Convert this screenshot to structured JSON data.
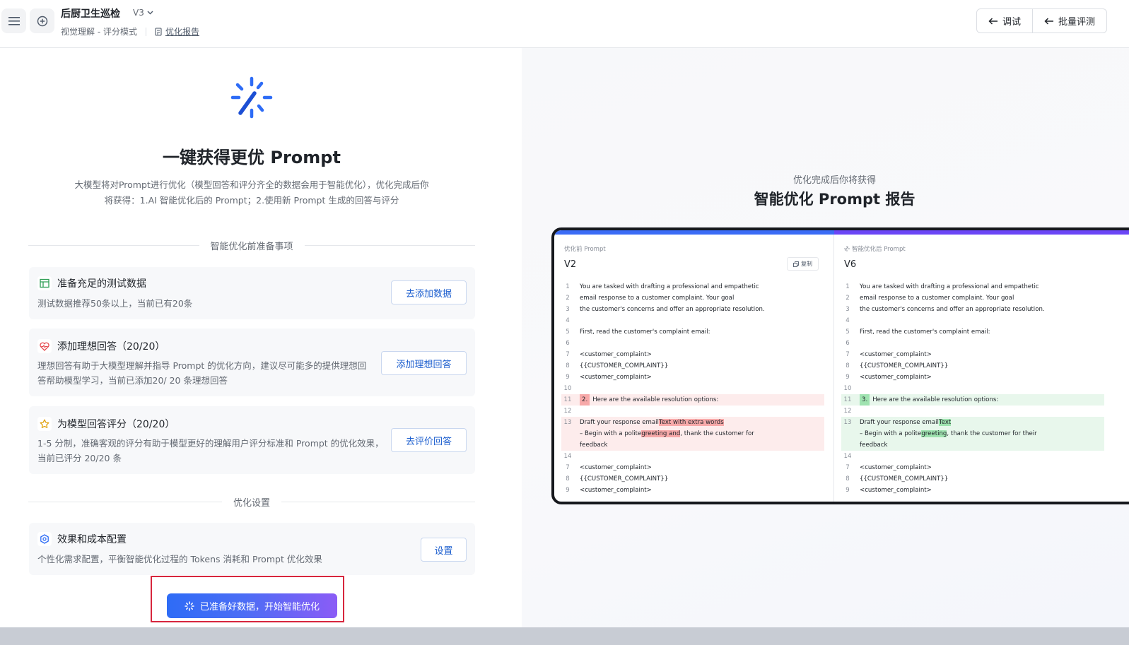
{
  "header": {
    "title": "后厨卫生巡检",
    "version": "V3",
    "mode": "视觉理解 - 评分模式",
    "report_link": "优化报告",
    "debug_label": "调试",
    "batch_label": "批量评测"
  },
  "hero": {
    "title": "一键获得更优 Prompt",
    "desc_line1": "大模型将对Prompt进行优化（模型回答和评分齐全的数据会用于智能优化），优化完成后你",
    "desc_line2": "将获得：1.AI 智能优化后的 Prompt；2.使用新 Prompt 生成的回答与评分"
  },
  "prep": {
    "heading": "智能优化前准备事项",
    "cards": [
      {
        "title": "准备充足的测试数据",
        "desc1": "测试数据推荐50条以上，当前已有20条",
        "desc2": "",
        "button": "去添加数据"
      },
      {
        "title": "添加理想回答（20/20）",
        "desc1": "理想回答有助于大模型理解并指导 Prompt 的优化方向，建议尽可能多的提供理想回",
        "desc2": "答帮助模型学习，当前已添加20/ 20 条理想回答",
        "button": "添加理想回答"
      },
      {
        "title": "为模型回答评分（20/20）",
        "desc1": "1-5 分制，准确客观的评分有助于模型更好的理解用户评分标准和 Prompt 的优化效果，",
        "desc2": "当前已评分 20/20 条",
        "button": "去评价回答"
      }
    ]
  },
  "settings": {
    "heading": "优化设置",
    "card": {
      "title": "效果和成本配置",
      "desc": "个性化需求配置，平衡智能优化过程的 Tokens 消耗和 Prompt 优化效果",
      "button": "设置"
    }
  },
  "start_button": "已准备好数据，开始智能优化",
  "preview": {
    "subtitle": "优化完成后你将获得",
    "title": "智能优化 Prompt 报告",
    "left": {
      "label": "优化前 Prompt",
      "version": "V2",
      "copy": "复制"
    },
    "right": {
      "label": "智能优化后 Prompt",
      "version": "V6"
    },
    "lines_common": {
      "l1": "You are tasked with drafting a professional and empathetic",
      "l2": "email response to a customer complaint. Your goal",
      "l3": "the customer's concerns and offer an appropriate resolution.",
      "l5": "First, read the customer's complaint email:",
      "cc": "<customer_complaint>",
      "ccv": "{{CUSTOMER_COMPLAINT}}",
      "opt": "Here are the available resolution options:",
      "draft": "Draft your response email",
      "begin": "– Begin with a polite",
      "fb": "feedback"
    },
    "left_diff": {
      "mark": "2.",
      "extra": "Text with extra words",
      "hl": "greeting and",
      "tail": ", thank the customer for"
    },
    "right_diff": {
      "mark": "3.",
      "extra": "Text",
      "hl": "greeting",
      "tail": ", thank the customer for their"
    },
    "line_numbers": [
      "1",
      "2",
      "3",
      "4",
      "5",
      "6",
      "7",
      "8",
      "9",
      "10",
      "11",
      "12",
      "13",
      "14",
      "7",
      "8",
      "9"
    ]
  }
}
